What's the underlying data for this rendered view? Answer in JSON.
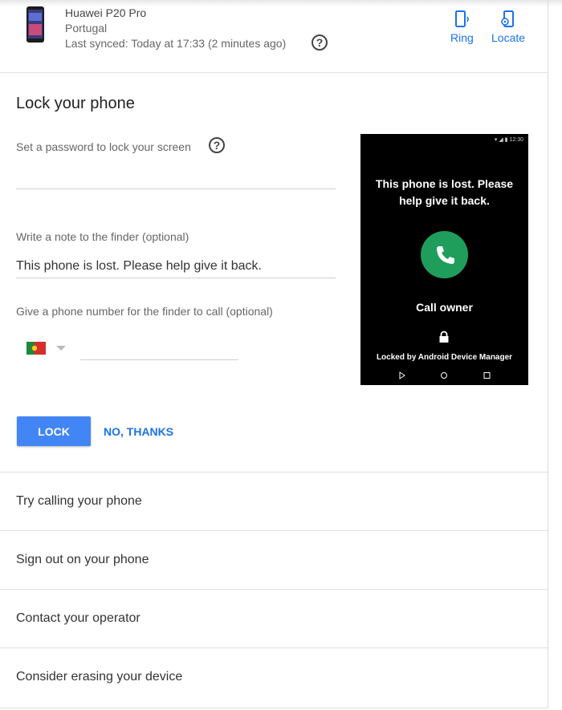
{
  "device": {
    "name": "Huawei P20 Pro",
    "location": "Portugal",
    "last_synced": "Last synced: Today at 17:33 (2 minutes ago)",
    "help_glyph": "?",
    "actions": {
      "ring": "Ring",
      "locate": "Locate"
    }
  },
  "lock_section": {
    "title": "Lock your phone",
    "password_label": "Set a password to lock your screen",
    "password_value": "",
    "note_label": "Write a note to the finder (optional)",
    "note_value": "This phone is lost. Please help give it back.",
    "phone_label": "Give a phone number for the finder to call (optional)",
    "phone_value": "",
    "country_flag": "Portugal",
    "lock_button": "LOCK",
    "no_thanks_button": "NO, THANKS"
  },
  "preview": {
    "status_time": "12:30",
    "message": "This phone is lost. Please help give it back.",
    "call_owner": "Call owner",
    "locked_by": "Locked by Android Device Manager",
    "call_color": "#1e9e5a"
  },
  "options": [
    {
      "label": "Try calling your phone"
    },
    {
      "label": "Sign out on your phone"
    },
    {
      "label": "Contact your operator"
    },
    {
      "label": "Consider erasing your device"
    }
  ],
  "colors": {
    "accent": "#1a73e8",
    "lock_button_bg": "#4285f4"
  }
}
